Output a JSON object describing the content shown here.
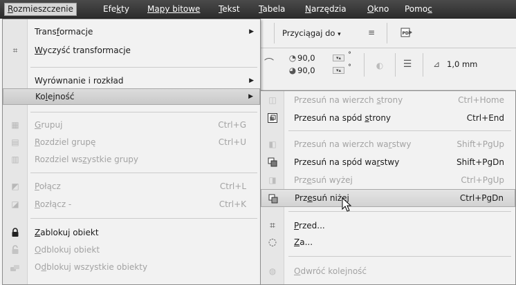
{
  "menubar": {
    "items": [
      {
        "pre": "",
        "u": "R",
        "post": "ozmieszczenie"
      },
      {
        "pre": "Efe",
        "u": "k",
        "post": "ty"
      },
      {
        "pre": "Mapy bitowe",
        "u": "",
        "post": ""
      },
      {
        "pre": "",
        "u": "T",
        "post": "ekst"
      },
      {
        "pre": "",
        "u": "T",
        "post": "abela"
      },
      {
        "pre": "",
        "u": "N",
        "post": "arzędzia"
      },
      {
        "pre": "",
        "u": "O",
        "post": "kno"
      },
      {
        "pre": "Pomo",
        "u": "c",
        "post": ""
      }
    ]
  },
  "toolbar": {
    "snap_label": "Przyciągaj do",
    "angle1": "90,0",
    "angle2": "90,0",
    "degree": "°",
    "outline_width": "1,0 mm"
  },
  "main_menu": {
    "items": [
      {
        "pre": "Trans",
        "u": "f",
        "post": "ormacje",
        "shortcut": "",
        "submenu": true,
        "disabled": false,
        "icon": ""
      },
      {
        "pre": "",
        "u": "W",
        "post": "yczyść transformacje",
        "shortcut": "",
        "submenu": false,
        "disabled": false,
        "icon": "clear-transform-icon"
      },
      {
        "pre": "Wyrównanie i rozkład",
        "u": "",
        "post": "",
        "shortcut": "",
        "submenu": true,
        "disabled": false,
        "icon": ""
      },
      {
        "pre": "Ko",
        "u": "l",
        "post": "ejność",
        "shortcut": "",
        "submenu": true,
        "disabled": false,
        "icon": ""
      },
      {
        "pre": "",
        "u": "G",
        "post": "rupuj",
        "shortcut": "Ctrl+G",
        "submenu": false,
        "disabled": true,
        "icon": "group-icon"
      },
      {
        "pre": "",
        "u": "R",
        "post": "ozdziel grupę",
        "shortcut": "Ctrl+U",
        "submenu": false,
        "disabled": true,
        "icon": "ungroup-icon"
      },
      {
        "pre": "Rozdziel ws",
        "u": "z",
        "post": "ystkie grupy",
        "shortcut": "",
        "submenu": false,
        "disabled": true,
        "icon": "ungroup-all-icon"
      },
      {
        "pre": "",
        "u": "P",
        "post": "ołącz",
        "shortcut": "Ctrl+L",
        "submenu": false,
        "disabled": true,
        "icon": "combine-icon"
      },
      {
        "pre": "",
        "u": "R",
        "post": "ozłącz -",
        "shortcut": "Ctrl+K",
        "submenu": false,
        "disabled": true,
        "icon": "break-apart-icon"
      },
      {
        "pre": "",
        "u": "Z",
        "post": "ablokuj obiekt",
        "shortcut": "",
        "submenu": false,
        "disabled": false,
        "icon": "lock-icon"
      },
      {
        "pre": "",
        "u": "O",
        "post": "dblokuj obiekt",
        "shortcut": "",
        "submenu": false,
        "disabled": true,
        "icon": "unlock-icon"
      },
      {
        "pre": "O",
        "u": "d",
        "post": "blokuj wszystkie obiekty",
        "shortcut": "",
        "submenu": false,
        "disabled": true,
        "icon": "unlock-all-icon"
      }
    ]
  },
  "submenu": {
    "items": [
      {
        "pre": "Przesuń na wierzch ",
        "u": "s",
        "post": "trony",
        "shortcut": "Ctrl+Home",
        "disabled": true,
        "icon": "to-front-of-page-icon"
      },
      {
        "pre": "Przesuń na spód ",
        "u": "s",
        "post": "trony",
        "shortcut": "Ctrl+End",
        "disabled": false,
        "icon": "to-back-of-page-icon"
      },
      {
        "pre": "Przesuń na wierzch wa",
        "u": "r",
        "post": "stwy",
        "shortcut": "Shift+PgUp",
        "disabled": true,
        "icon": "to-front-of-layer-icon"
      },
      {
        "pre": "Przesuń na spód wa",
        "u": "r",
        "post": "stwy",
        "shortcut": "Shift+PgDn",
        "disabled": false,
        "icon": "to-back-of-layer-icon"
      },
      {
        "pre": "Prz",
        "u": "e",
        "post": "suń wyżej",
        "shortcut": "Ctrl+PgUp",
        "disabled": true,
        "icon": "forward-one-icon"
      },
      {
        "pre": "Prz",
        "u": "e",
        "post": "suń niżej",
        "shortcut": "Ctrl+PgDn",
        "disabled": false,
        "icon": "back-one-icon"
      },
      {
        "pre": "",
        "u": "P",
        "post": "rzed...",
        "shortcut": "",
        "disabled": false,
        "icon": "in-front-of-icon"
      },
      {
        "pre": "",
        "u": "Z",
        "post": "a...",
        "shortcut": "",
        "disabled": false,
        "icon": "behind-icon"
      },
      {
        "pre": "",
        "u": "O",
        "post": "dwróć kolejność",
        "shortcut": "",
        "disabled": true,
        "icon": "reverse-order-icon"
      }
    ]
  },
  "colors": {
    "menubar_bg": "#2c2c2c",
    "menu_bg": "#f2f2f2",
    "disabled_text": "#a3a3a3",
    "highlight": "#d2d2d2"
  }
}
